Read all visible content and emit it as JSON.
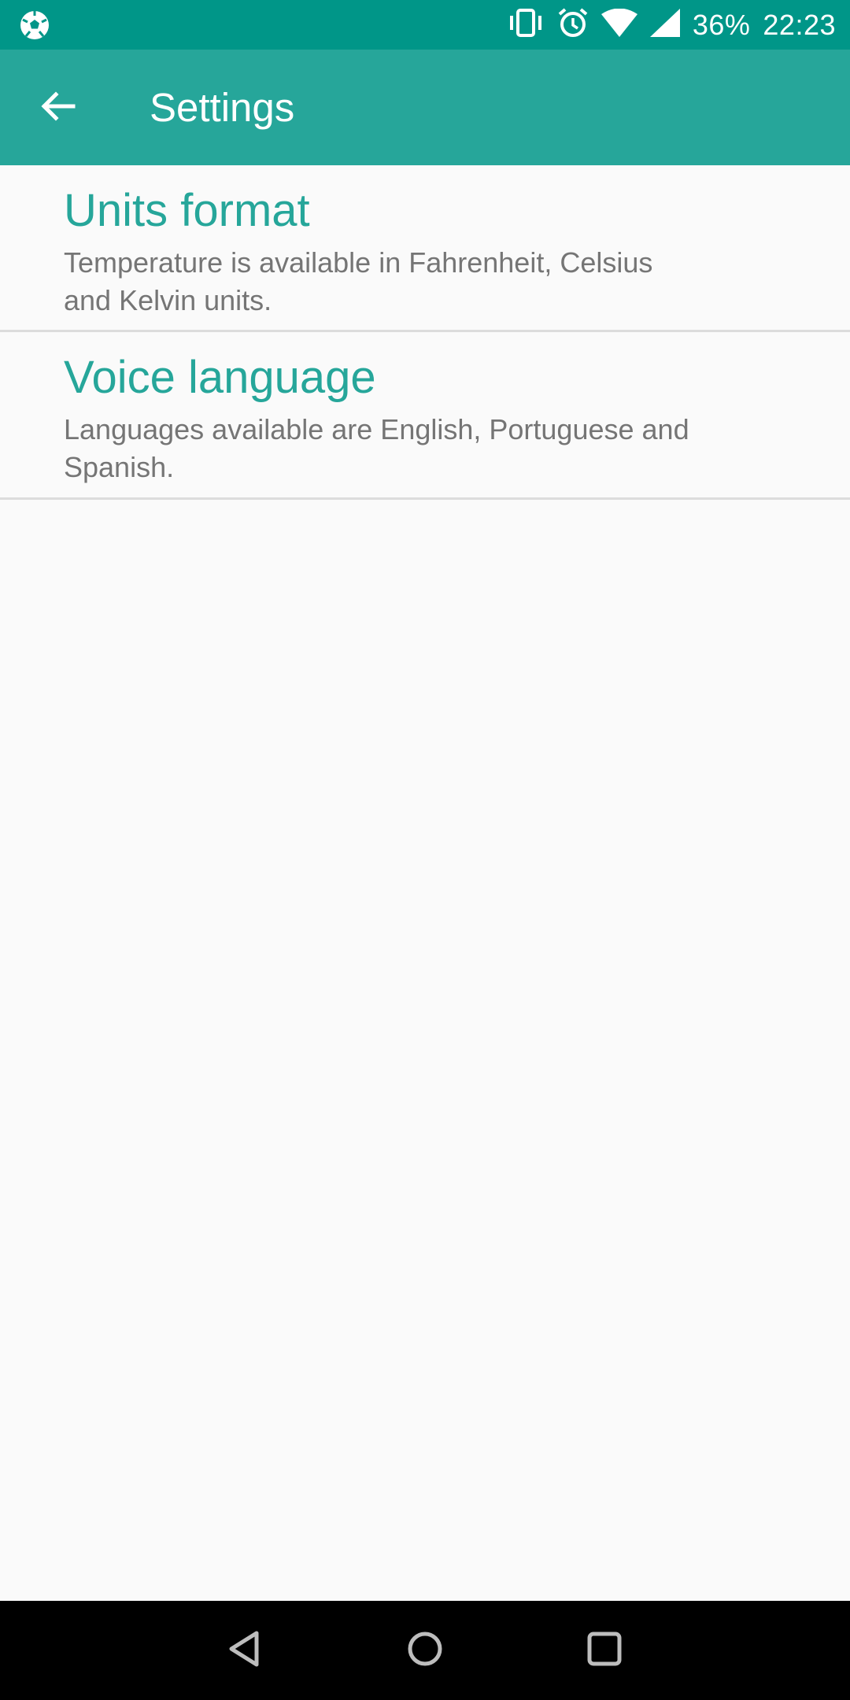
{
  "status_bar": {
    "battery": "36%",
    "time": "22:23",
    "icons": [
      "soccer-ball-icon",
      "vibrate-icon",
      "alarm-icon",
      "wifi-icon",
      "signal-icon"
    ]
  },
  "app_bar": {
    "title": "Settings",
    "back_icon": "arrow-back-icon"
  },
  "settings": {
    "items": [
      {
        "title": "Units format",
        "summary": "Temperature is available in Fahrenheit, Celsius and Kelvin units."
      },
      {
        "title": "Voice language",
        "summary": "Languages available are English, Portuguese and Spanish."
      }
    ]
  },
  "nav_bar": {
    "icons": [
      "back-triangle-icon",
      "home-circle-icon",
      "recents-square-icon"
    ]
  },
  "colors": {
    "status_bar": "#009688",
    "app_bar": "#26a69a",
    "accent": "#26a69a",
    "summary_text": "#757575",
    "background": "#fafafa"
  }
}
